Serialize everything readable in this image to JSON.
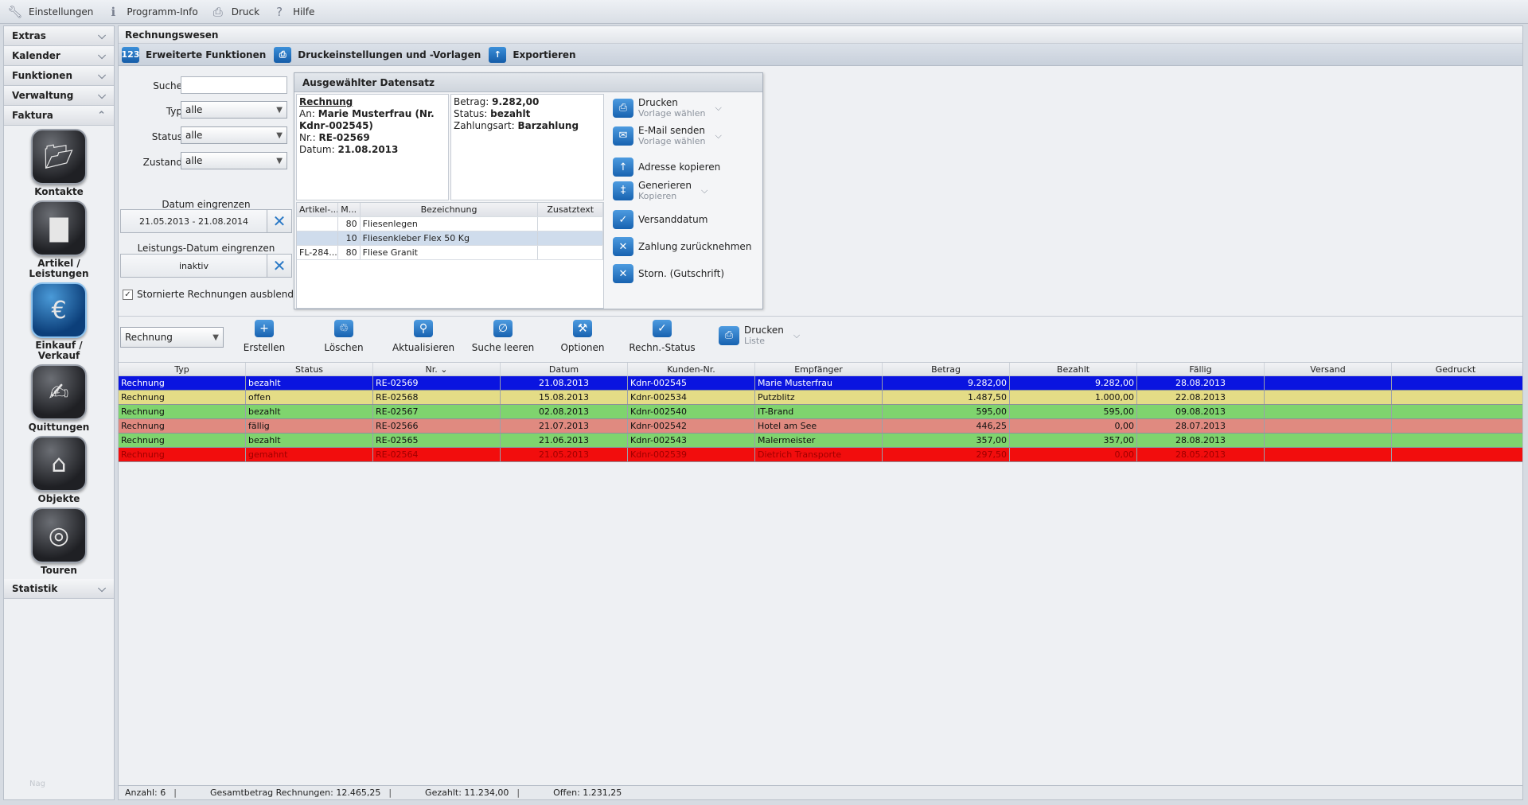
{
  "topmenu": [
    {
      "label": "Einstellungen",
      "icon": "wrench-icon"
    },
    {
      "label": "Programm-Info",
      "icon": "info-icon"
    },
    {
      "label": "Druck",
      "icon": "printer-icon"
    },
    {
      "label": "Hilfe",
      "icon": "help-icon"
    }
  ],
  "sidebar": {
    "sections_top": [
      {
        "label": "Extras"
      },
      {
        "label": "Kalender"
      },
      {
        "label": "Funktionen"
      },
      {
        "label": "Verwaltung"
      },
      {
        "label": "Faktura"
      }
    ],
    "modules": [
      {
        "label": "Kontakte",
        "icon": "folder-icon"
      },
      {
        "label": "Artikel / Leistungen",
        "icon": "bar-chart-icon"
      },
      {
        "label": "Einkauf / Verkauf",
        "icon": "money-icon"
      },
      {
        "label": "Quittungen",
        "icon": "pen-document-icon"
      },
      {
        "label": "Objekte",
        "icon": "house-icon"
      },
      {
        "label": "Touren",
        "icon": "globe-icon"
      }
    ],
    "section_bottom": {
      "label": "Statistik"
    },
    "footer": "Nag"
  },
  "main": {
    "title": "Rechnungswesen",
    "toolbar": [
      {
        "label": "Erweiterte Funktionen",
        "icon": "123-icon"
      },
      {
        "label": "Druckeinstellungen und -Vorlagen",
        "icon": "printer-icon"
      },
      {
        "label": "Exportieren",
        "icon": "export-arrow-icon"
      }
    ]
  },
  "filters": {
    "search_label": "Suche",
    "search_value": "",
    "typ_label": "Typ",
    "typ_value": "alle",
    "status_label": "Status",
    "status_value": "alle",
    "zustand_label": "Zustand",
    "zustand_value": "alle",
    "date_label": "Datum eingrenzen",
    "date_value": "21.05.2013 - 21.08.2014",
    "ldate_label": "Leistungs-Datum eingrenzen",
    "ldate_value": "inaktiv",
    "storno_label": "Stornierte Rechnungen ausblenden",
    "storno_checked": true
  },
  "detail": {
    "title": "Ausgewählter Datensatz",
    "heading": "Rechnung",
    "an_label": "An:",
    "an_value": "Marie Musterfrau (Nr. Kdnr-002545)",
    "nr_label": "Nr.:",
    "nr_value": "RE-02569",
    "datum_label": "Datum:",
    "datum_value": "21.08.2013",
    "betrag_label": "Betrag:",
    "betrag_value": "9.282,00",
    "status_label": "Status:",
    "status_value": "bezahlt",
    "zahlungsart_label": "Zahlungsart:",
    "zahlungsart_value": "Barzahlung",
    "items_columns": [
      "Artikel-...",
      "M...",
      "Bezeichnung",
      "Zusatztext"
    ],
    "items": [
      {
        "artikel": "",
        "menge": "80",
        "bez": "Fliesenlegen",
        "zusatz": ""
      },
      {
        "artikel": "",
        "menge": "10",
        "bez": "Fliesenkleber Flex 50 Kg",
        "zusatz": ""
      },
      {
        "artikel": "FL-284...",
        "menge": "80",
        "bez": "Fliese Granit",
        "zusatz": ""
      }
    ],
    "actions": {
      "drucken": "Drucken",
      "drucken_sub": "Vorlage wählen",
      "email": "E-Mail senden",
      "email_sub": "Vorlage wählen",
      "adresse": "Adresse kopieren",
      "generieren": "Generieren",
      "generieren_sub": "Kopieren",
      "versand": "Versanddatum",
      "zahlung": "Zahlung zurücknehmen",
      "storno": "Storn. (Gutschrift)"
    }
  },
  "toolbar2": {
    "type_value": "Rechnung",
    "buttons": [
      "Erstellen",
      "Löschen",
      "Aktualisieren",
      "Suche leeren",
      "Optionen",
      "Rechn.-Status"
    ],
    "druck_label": "Drucken",
    "druck_sub": "Liste"
  },
  "grid": {
    "columns": [
      "Typ",
      "Status",
      "Nr.",
      "Datum",
      "Kunden-Nr.",
      "Empfänger",
      "Betrag",
      "Bezahlt",
      "Fällig",
      "Versand",
      "Gedruckt"
    ],
    "sort_column": "Nr.",
    "rows": [
      {
        "typ": "Rechnung",
        "status": "bezahlt",
        "nr": "RE-02569",
        "datum": "21.08.2013",
        "kunde": "Kdnr-002545",
        "empf": "Marie Musterfrau",
        "betrag": "9.282,00",
        "bezahlt": "9.282,00",
        "faellig": "28.08.2013",
        "versand": "",
        "gedruckt": "",
        "bg": "#0a14e0",
        "fg": "#ffffff"
      },
      {
        "typ": "Rechnung",
        "status": "offen",
        "nr": "RE-02568",
        "datum": "15.08.2013",
        "kunde": "Kdnr-002534",
        "empf": "Putzblitz",
        "betrag": "1.487,50",
        "bezahlt": "1.000,00",
        "faellig": "22.08.2013",
        "versand": "",
        "gedruckt": "",
        "bg": "#e4dc86",
        "fg": "#111111"
      },
      {
        "typ": "Rechnung",
        "status": "bezahlt",
        "nr": "RE-02567",
        "datum": "02.08.2013",
        "kunde": "Kdnr-002540",
        "empf": "IT-Brand",
        "betrag": "595,00",
        "bezahlt": "595,00",
        "faellig": "09.08.2013",
        "versand": "",
        "gedruckt": "",
        "bg": "#7fd46e",
        "fg": "#111111"
      },
      {
        "typ": "Rechnung",
        "status": "fällig",
        "nr": "RE-02566",
        "datum": "21.07.2013",
        "kunde": "Kdnr-002542",
        "empf": "Hotel am See",
        "betrag": "446,25",
        "bezahlt": "0,00",
        "faellig": "28.07.2013",
        "versand": "",
        "gedruckt": "",
        "bg": "#e08a80",
        "fg": "#111111"
      },
      {
        "typ": "Rechnung",
        "status": "bezahlt",
        "nr": "RE-02565",
        "datum": "21.06.2013",
        "kunde": "Kdnr-002543",
        "empf": "Malermeister",
        "betrag": "357,00",
        "bezahlt": "357,00",
        "faellig": "28.08.2013",
        "versand": "",
        "gedruckt": "",
        "bg": "#7fd46e",
        "fg": "#111111"
      },
      {
        "typ": "Rechnung",
        "status": "gemahnt",
        "nr": "RE-02564",
        "datum": "21.05.2013",
        "kunde": "Kdnr-002539",
        "empf": "Dietrich Transporte",
        "betrag": "297,50",
        "bezahlt": "0,00",
        "faellig": "28.05.2013",
        "versand": "",
        "gedruckt": "",
        "bg": "#f20d0d",
        "fg": "#a00000"
      }
    ]
  },
  "statusbar": {
    "anzahl": "Anzahl: 6",
    "gesamt": "Gesamtbetrag Rechnungen: 12.465,25",
    "gezahlt": "Gezahlt: 11.234,00",
    "offen": "Offen: 1.231,25"
  }
}
